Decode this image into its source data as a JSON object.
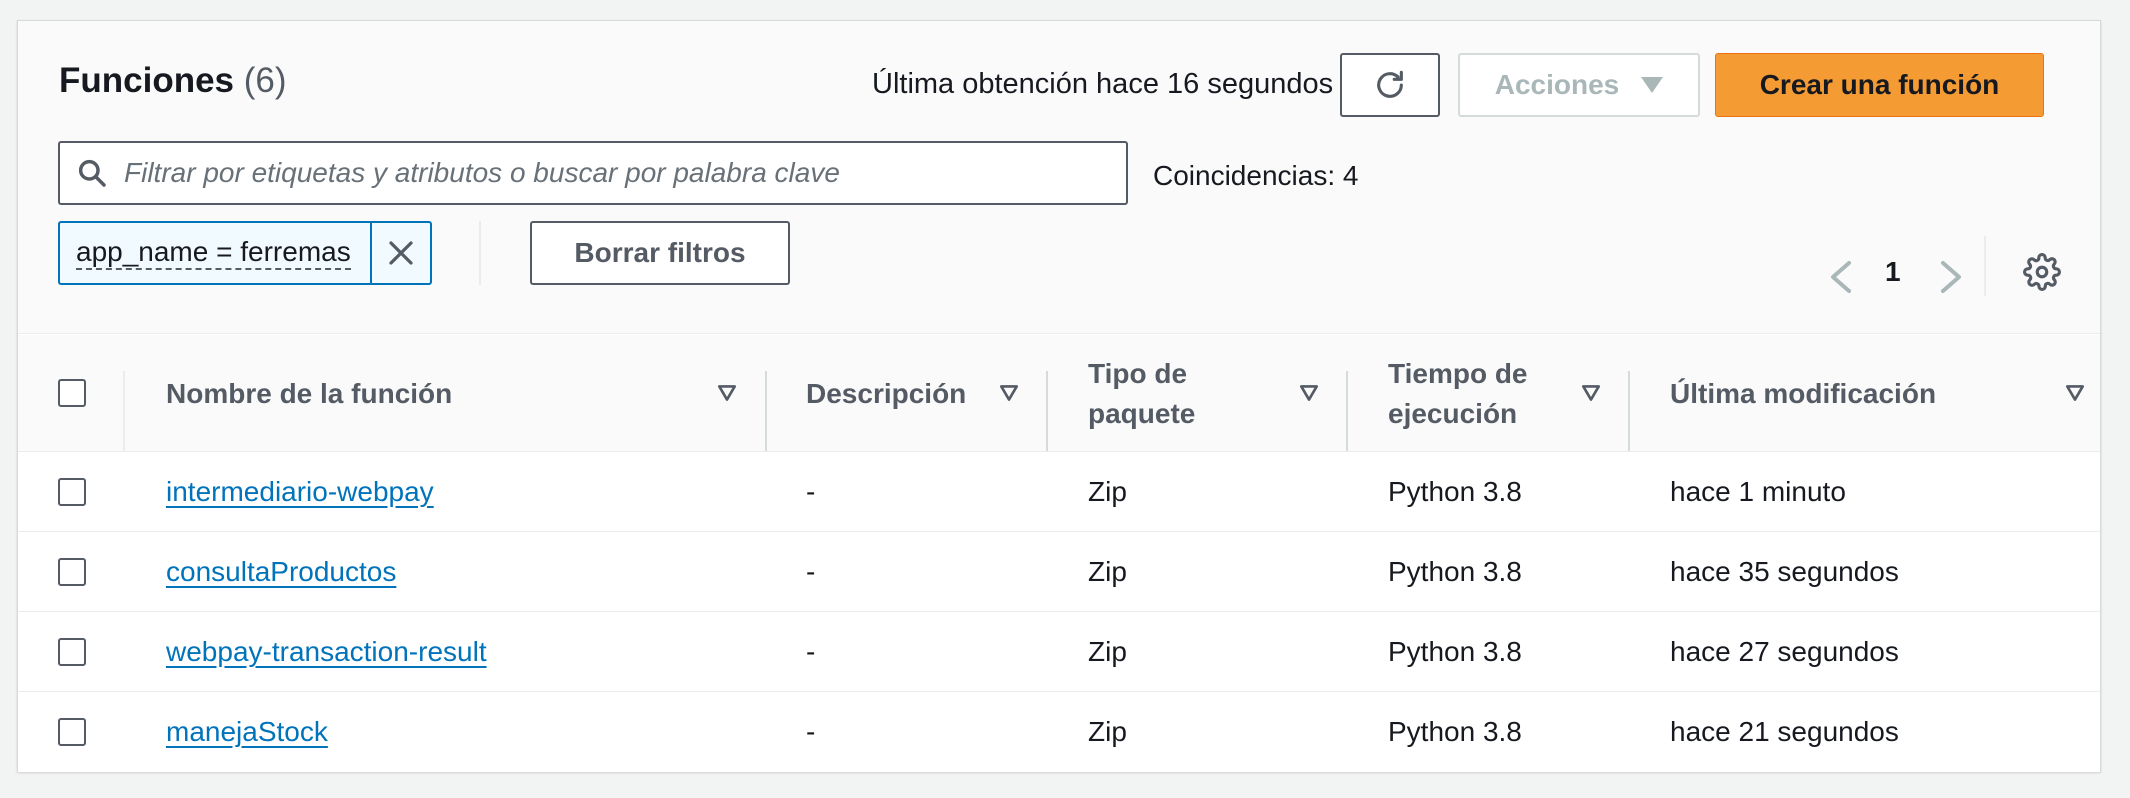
{
  "header": {
    "title": "Funciones",
    "count": "(6)",
    "last_fetch": "Última obtención hace 16 segundos",
    "actions_label": "Acciones",
    "create_label": "Crear una función"
  },
  "filter": {
    "placeholder": "Filtrar por etiquetas y atributos o buscar por palabra clave",
    "matches": "Coincidencias: 4",
    "token": "app_name = ferremas",
    "clear_label": "Borrar filtros"
  },
  "pagination": {
    "current_page": "1"
  },
  "table": {
    "columns": [
      {
        "line1": "Nombre de la función",
        "line2": ""
      },
      {
        "line1": "Descripción",
        "line2": ""
      },
      {
        "line1": "Tipo de",
        "line2": "paquete"
      },
      {
        "line1": "Tiempo de",
        "line2": "ejecución"
      },
      {
        "line1": "Última modificación",
        "line2": ""
      }
    ],
    "rows": [
      {
        "name": "intermediario-webpay",
        "description": "-",
        "package": "Zip",
        "runtime": "Python 3.8",
        "modified": "hace 1 minuto"
      },
      {
        "name": "consultaProductos",
        "description": "-",
        "package": "Zip",
        "runtime": "Python 3.8",
        "modified": "hace 35 segundos"
      },
      {
        "name": "webpay-transaction-result",
        "description": "-",
        "package": "Zip",
        "runtime": "Python 3.8",
        "modified": "hace 27 segundos"
      },
      {
        "name": "manejaStock",
        "description": "-",
        "package": "Zip",
        "runtime": "Python 3.8",
        "modified": "hace 21 segundos"
      }
    ]
  },
  "colors": {
    "primary_button": "#f49b34",
    "link": "#0073bb",
    "token_border": "#0073bb",
    "disabled_text": "#aab7b8"
  },
  "icons": {
    "refresh": "refresh-icon",
    "search": "search-icon",
    "close": "close-icon",
    "prev": "chevron-left-icon",
    "next": "chevron-right-icon",
    "settings": "gear-icon",
    "sort": "sort-caret-icon"
  }
}
